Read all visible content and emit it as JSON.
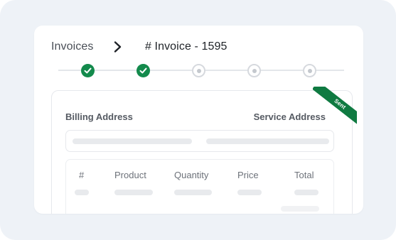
{
  "breadcrumb": {
    "root": "Invoices",
    "separator_icon": "chevron-right-icon",
    "current": "# Invoice - 1595"
  },
  "stepper": {
    "steps": [
      {
        "status": "completed",
        "icon": "check-icon"
      },
      {
        "status": "completed",
        "icon": "check-icon"
      },
      {
        "status": "pending",
        "icon": "dot-icon"
      },
      {
        "status": "pending",
        "icon": "dot-icon"
      },
      {
        "status": "pending",
        "icon": "dot-icon"
      }
    ],
    "completed_color": "#138a4c",
    "pending_color": "#c4c8ce"
  },
  "invoice": {
    "ribbon_label": "Sent",
    "ribbon_color": "#0f7a41",
    "billing_address_label": "Billing Address",
    "service_address_label": "Service Address",
    "table": {
      "columns": [
        "#",
        "Product",
        "Quantity",
        "Price",
        "Total"
      ]
    }
  },
  "colors": {
    "backdrop": "#eef2f7",
    "card": "#ffffff",
    "text_primary": "#1f2328",
    "text_secondary": "#555a62",
    "skeleton": "#e8eaed"
  }
}
